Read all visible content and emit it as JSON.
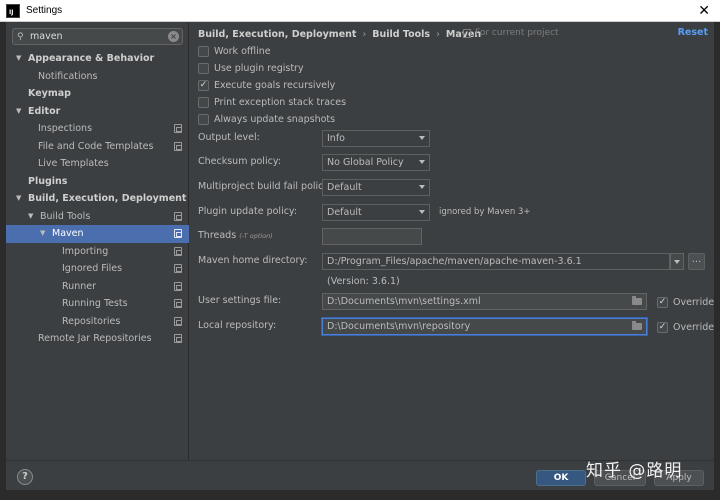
{
  "window": {
    "title": "Settings",
    "app_icon_text": "IJ"
  },
  "search": {
    "value": "maven"
  },
  "tree": [
    {
      "label": "Appearance & Behavior",
      "level": 0,
      "expanded": true,
      "bold": true
    },
    {
      "label": "Notifications",
      "level": 1
    },
    {
      "label": "Keymap",
      "level": 0,
      "bold": true
    },
    {
      "label": "Editor",
      "level": 0,
      "expanded": true,
      "bold": true
    },
    {
      "label": "Inspections",
      "level": 1,
      "project": true
    },
    {
      "label": "File and Code Templates",
      "level": 1,
      "project": true
    },
    {
      "label": "Live Templates",
      "level": 1
    },
    {
      "label": "Plugins",
      "level": 0,
      "bold": true
    },
    {
      "label": "Build, Execution, Deployment",
      "level": 0,
      "expanded": true,
      "bold": true
    },
    {
      "label": "Build Tools",
      "level": 1,
      "expanded": true,
      "project": true
    },
    {
      "label": "Maven",
      "level": 2,
      "expanded": true,
      "project": true,
      "selected": true
    },
    {
      "label": "Importing",
      "level": 3,
      "project": true
    },
    {
      "label": "Ignored Files",
      "level": 3,
      "project": true
    },
    {
      "label": "Runner",
      "level": 3,
      "project": true
    },
    {
      "label": "Running Tests",
      "level": 3,
      "project": true
    },
    {
      "label": "Repositories",
      "level": 3,
      "project": true
    },
    {
      "label": "Remote Jar Repositories",
      "level": 1,
      "project": true
    }
  ],
  "breadcrumb": [
    "Build, Execution, Deployment",
    "Build Tools",
    "Maven"
  ],
  "for_project": "For current project",
  "reset_label": "Reset",
  "checkboxes": [
    {
      "label": "Work offline",
      "checked": false
    },
    {
      "label": "Use plugin registry",
      "checked": false
    },
    {
      "label": "Execute goals recursively",
      "checked": true
    },
    {
      "label": "Print exception stack traces",
      "checked": false
    },
    {
      "label": "Always update snapshots",
      "checked": false
    }
  ],
  "output_level": {
    "label": "Output level:",
    "value": "Info"
  },
  "checksum_policy": {
    "label": "Checksum policy:",
    "value": "No Global Policy"
  },
  "multiproject_policy": {
    "label": "Multiproject build fail policy:",
    "value": "Default"
  },
  "plugin_update_policy": {
    "label": "Plugin update policy:",
    "value": "Default",
    "hint": "ignored by Maven 3+"
  },
  "threads": {
    "label": "Threads",
    "sub": "(-T option)",
    "value": ""
  },
  "maven_home": {
    "label": "Maven home directory:",
    "value": "D:/Program_Files/apache/maven/apache-maven-3.6.1",
    "version": "(Version: 3.6.1)",
    "browse": "..."
  },
  "user_settings": {
    "label": "User settings file:",
    "value": "D:\\Documents\\mvn\\settings.xml",
    "override_label": "Override",
    "override_checked": true
  },
  "local_repo": {
    "label": "Local repository:",
    "value": "D:\\Documents\\mvn\\repository",
    "override_label": "Override",
    "override_checked": true
  },
  "buttons": {
    "help": "?",
    "ok": "OK",
    "cancel": "Cancel",
    "apply": "Apply"
  },
  "watermark": "知乎 @路明"
}
